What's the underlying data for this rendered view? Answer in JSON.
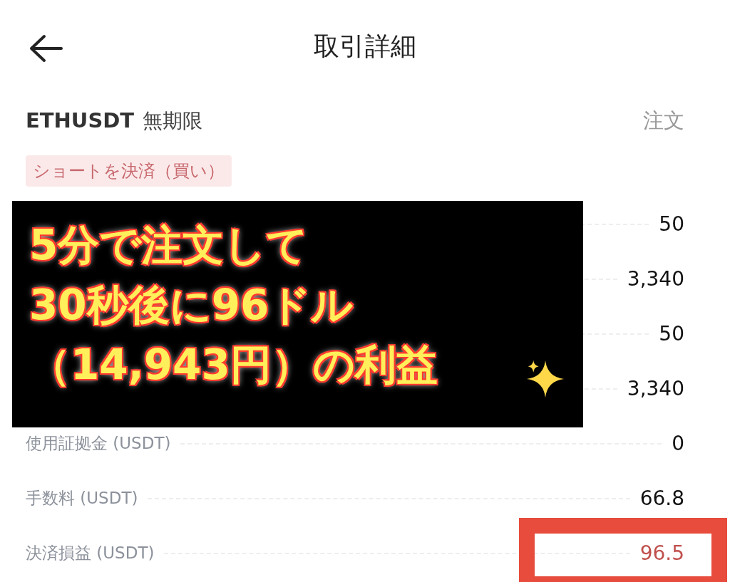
{
  "header": {
    "title": "取引詳細"
  },
  "symbol": {
    "pair": "ETHUSDT",
    "type": "無期限",
    "action": "注文"
  },
  "tag": {
    "label": "ショートを決済（買い）"
  },
  "rows": [
    {
      "value": "50",
      "highlighted": false
    },
    {
      "value": "3,340",
      "highlighted": false
    },
    {
      "value": "50",
      "highlighted": false
    },
    {
      "value": "3,340",
      "highlighted": false
    },
    {
      "label": "使用証拠金 (USDT)",
      "value": "0",
      "highlighted": false
    },
    {
      "label": "手数料 (USDT)",
      "value": "66.8",
      "highlighted": false
    },
    {
      "label": "決済損益 (USDT)",
      "value": "96.5",
      "highlighted": true
    }
  ],
  "overlay": {
    "lines": [
      "5分で注文して",
      "30秒後に96ドル",
      "（14,943円）の利益"
    ]
  }
}
